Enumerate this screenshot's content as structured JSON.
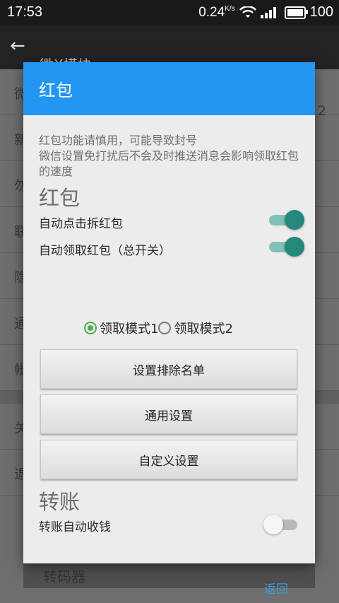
{
  "status_bar": {
    "time": "17:53",
    "net_speed": "0.24",
    "net_unit": "K/s",
    "battery": "100"
  },
  "background": {
    "title": "微X模块",
    "rows": [
      "微",
      "新",
      "勿",
      "联",
      "隐",
      "通",
      "帐"
    ],
    "extra_value": "2",
    "rows2": [
      "关",
      "退"
    ],
    "bottom_card": "转码器"
  },
  "dialog": {
    "title": "红包",
    "warning": "红包功能请慎用，可能导致封号\n微信设置免打扰后不会及时推送消息会影响领取红包的速度",
    "section_redpacket": "红包",
    "auto_open_label": "自动点击拆红包",
    "auto_open_on": true,
    "auto_receive_label": "自动领取红包（总开关）",
    "auto_receive_on": true,
    "mode1_label": "领取模式1",
    "mode2_label": "领取模式2",
    "selected_mode": 1,
    "exclude_button": "设置排除名单",
    "general_button": "通用设置",
    "custom_button": "自定义设置",
    "section_transfer": "转账",
    "auto_collect_label": "转账自动收钱",
    "auto_collect_on": false,
    "back_button": "返回",
    "accent_color": "#2196f3",
    "switch_on_color": "#24897a",
    "radio_color": "#4caf50"
  }
}
